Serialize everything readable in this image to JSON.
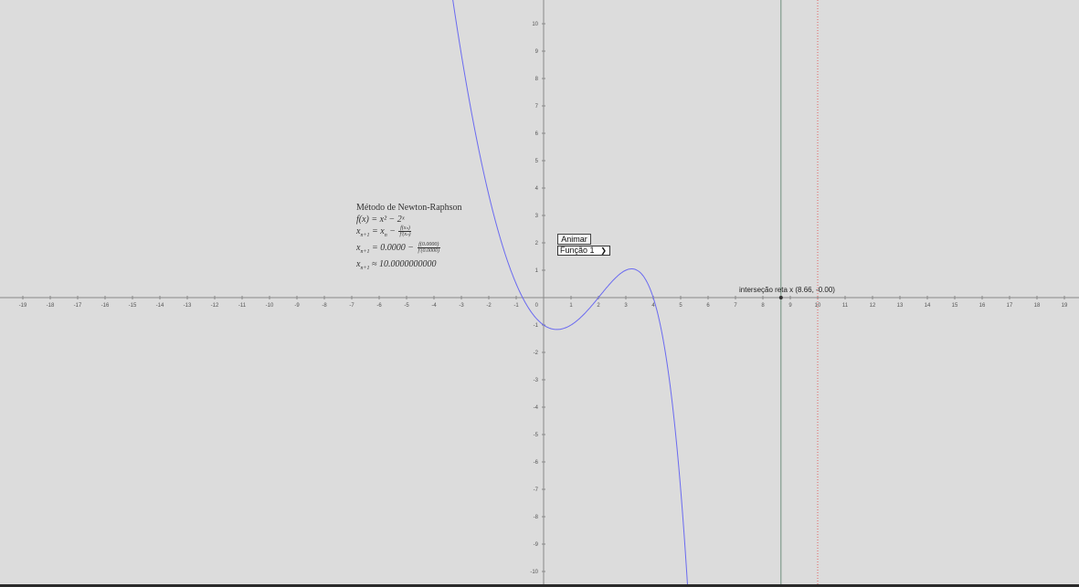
{
  "axes": {
    "x_range": [
      -19,
      19
    ],
    "y_range": [
      -10,
      10
    ],
    "axis_color": "#888888",
    "curve_color": "#6a6af0",
    "intersect_line_color": "#6f8f7f",
    "dotted_line_color": "#e06060"
  },
  "panel": {
    "title": "Método de Newton-Raphson",
    "function_lhs": "f(x) = ",
    "function_rhs": "x² − 2ˣ",
    "iter_lhs": "x",
    "iter_num": "f(xₙ)",
    "iter_den": "f′(xₙ)",
    "step_value": "0.0000",
    "step_num": "f(0.0000)",
    "step_den": "f′(0.0000)",
    "approx_value": "10.0000000000"
  },
  "controls": {
    "animate_label": "Animar",
    "function_selected": "Função 1"
  },
  "intersection": {
    "label": "interseção reta x (8.66, -0.00)",
    "x": 8.66,
    "y": 0
  },
  "dotted_x": 10
}
